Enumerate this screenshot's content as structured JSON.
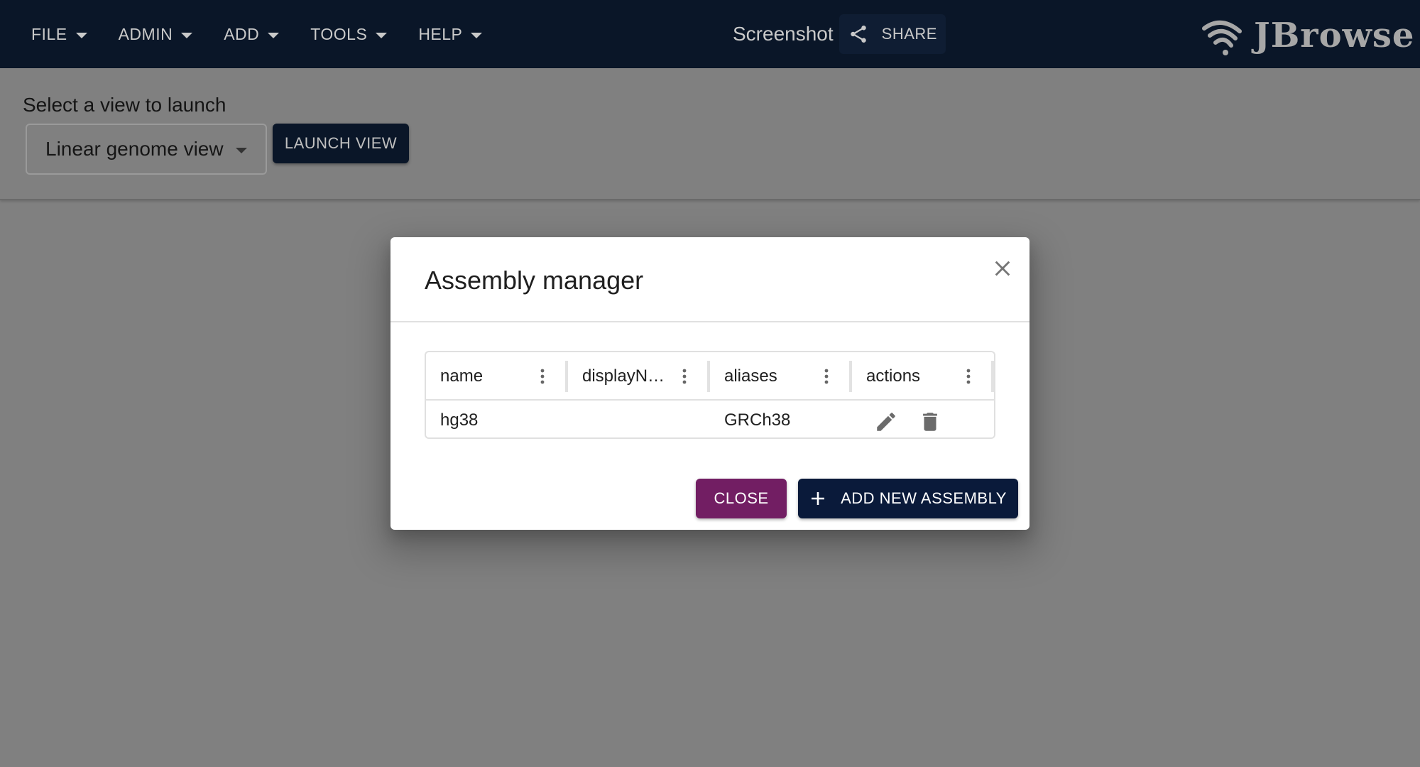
{
  "appbar": {
    "menu": [
      {
        "label": "FILE",
        "icon": "chevron-down-icon"
      },
      {
        "label": "ADMIN",
        "icon": "chevron-down-icon"
      },
      {
        "label": "ADD",
        "icon": "chevron-down-icon"
      },
      {
        "label": "TOOLS",
        "icon": "chevron-down-icon"
      },
      {
        "label": "HELP",
        "icon": "chevron-down-icon"
      }
    ],
    "session_name": "Screenshot",
    "share_label": "SHARE",
    "share_icon": "share-icon",
    "logo_text": "JBrowse",
    "background": "#0a1628"
  },
  "launcher": {
    "label": "Select a view to launch",
    "selected_view": "Linear genome view",
    "launch_label": "LAUNCH VIEW"
  },
  "dialog": {
    "title": "Assembly manager",
    "close_icon": "close-icon",
    "columns": [
      "name",
      "displayN…",
      "aliases",
      "actions"
    ],
    "rows": [
      {
        "name": "hg38",
        "displayName": "",
        "aliases": "GRCh38",
        "actions": [
          "edit-icon",
          "delete-icon"
        ]
      }
    ],
    "close_label": "CLOSE",
    "add_label": "ADD NEW ASSEMBLY",
    "close_color": "#721e63",
    "add_color": "#0a1a3a"
  }
}
